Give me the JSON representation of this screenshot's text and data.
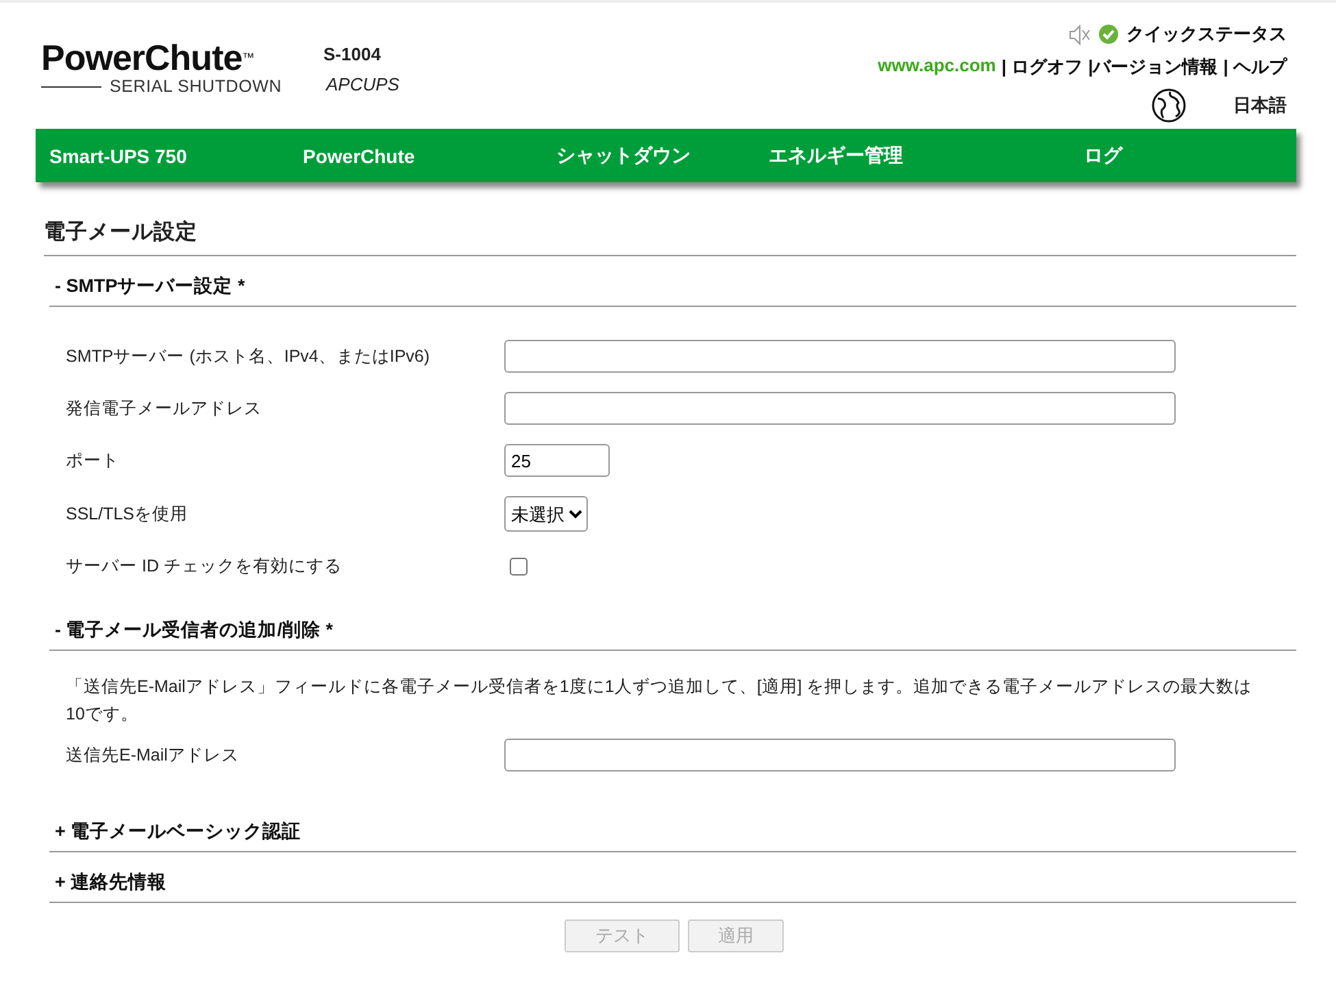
{
  "header": {
    "logo": {
      "title": "PowerChute",
      "tm": "™",
      "subtitle": "SERIAL SHUTDOWN"
    },
    "device": {
      "model": "S-1004",
      "name": "APCUPS"
    },
    "quick_status": {
      "label": "クイックステータス",
      "muted": true,
      "ok": true
    },
    "links": [
      {
        "label": "www.apc.com",
        "kind": "external"
      },
      {
        "label": "| ログオフ",
        "kind": "plain"
      },
      {
        "label": "|バージョン情報",
        "kind": "plain"
      },
      {
        "label": "| ヘルプ",
        "kind": "plain"
      }
    ],
    "language": "日本語"
  },
  "nav": [
    "Smart-UPS 750",
    "PowerChute",
    "シャットダウン",
    "エネルギー管理",
    "ログ"
  ],
  "page_title": "電子メール設定",
  "sections": [
    {
      "title": "- SMTPサーバー設定 *",
      "fields": [
        {
          "label": "SMTPサーバー (ホスト名、IPv4、またはIPv6)",
          "kind": "text"
        },
        {
          "label": "発信電子メールアドレス",
          "kind": "text"
        },
        {
          "label": "ポート",
          "kind": "short",
          "value": "25"
        },
        {
          "label": "SSL/TLSを使用",
          "kind": "select",
          "value": "未選択"
        },
        {
          "label": "サーバー ID チェックを有効にする",
          "kind": "checkbox",
          "checked": false
        }
      ]
    },
    {
      "title": "- 電子メール受信者の追加/削除 *",
      "note": "「送信先E-Mailアドレス」フィールドに各電子メール受信者を1度に1人ずつ追加して、[適用] を押します。追加できる電子メールアドレスの最大数は10です。",
      "fields": [
        {
          "label": "送信先E-Mailアドレス",
          "kind": "text"
        }
      ]
    },
    {
      "title": "+ 電子メールベーシック認証"
    },
    {
      "title": "+ 連絡先情報"
    }
  ],
  "buttons": [
    {
      "label": "テスト",
      "disabled": true
    },
    {
      "label": "適用",
      "disabled": true
    }
  ]
}
